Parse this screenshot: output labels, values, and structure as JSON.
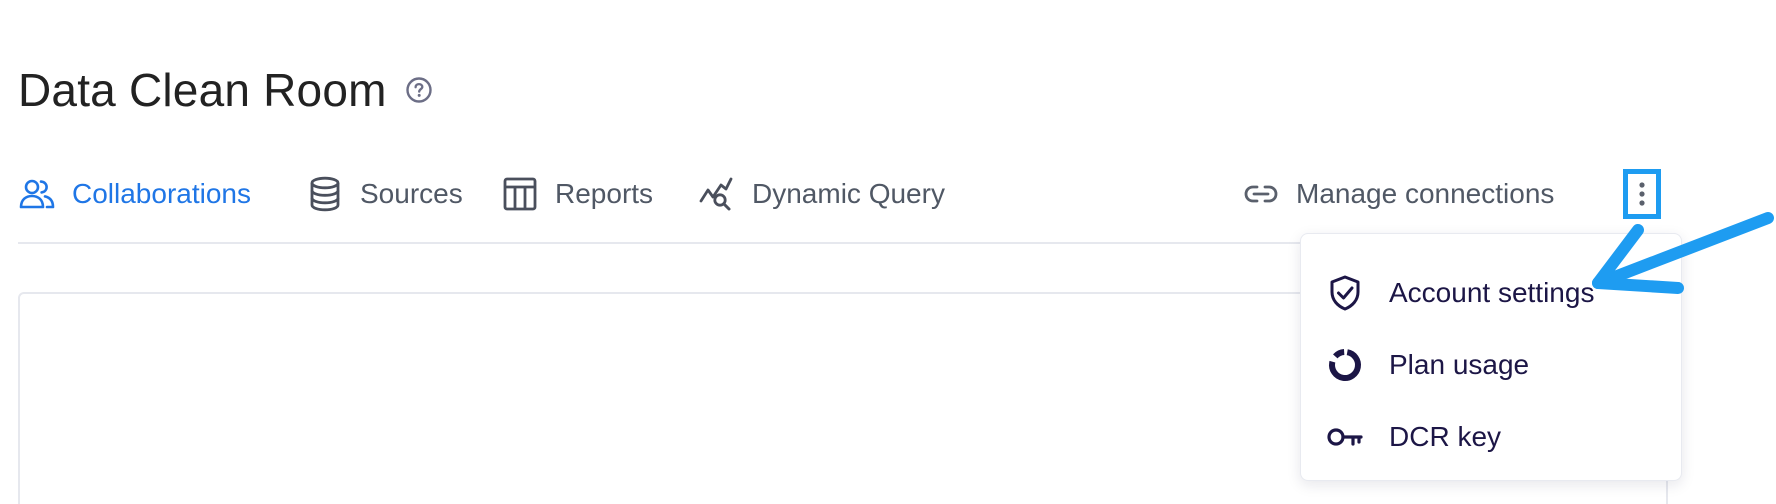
{
  "page": {
    "title": "Data Clean Room",
    "help_icon": "help-circle-icon"
  },
  "nav": {
    "tabs": [
      {
        "label": "Collaborations",
        "icon": "users-icon",
        "active": true
      },
      {
        "label": "Sources",
        "icon": "database-icon",
        "active": false
      },
      {
        "label": "Reports",
        "icon": "table-icon",
        "active": false
      },
      {
        "label": "Dynamic Query",
        "icon": "chart-search-icon",
        "active": false
      }
    ],
    "manage": {
      "label": "Manage connections",
      "icon": "link-icon"
    },
    "more_icon": "kebab-menu-icon"
  },
  "menu": {
    "items": [
      {
        "label": "Account settings",
        "icon": "shield-check-icon"
      },
      {
        "label": "Plan usage",
        "icon": "donut-icon"
      },
      {
        "label": "DCR key",
        "icon": "key-icon"
      }
    ]
  },
  "colors": {
    "active_tab": "#1f76e6",
    "tab_text": "#505865",
    "menu_text": "#1c1646",
    "highlight": "#1e9cf1"
  }
}
